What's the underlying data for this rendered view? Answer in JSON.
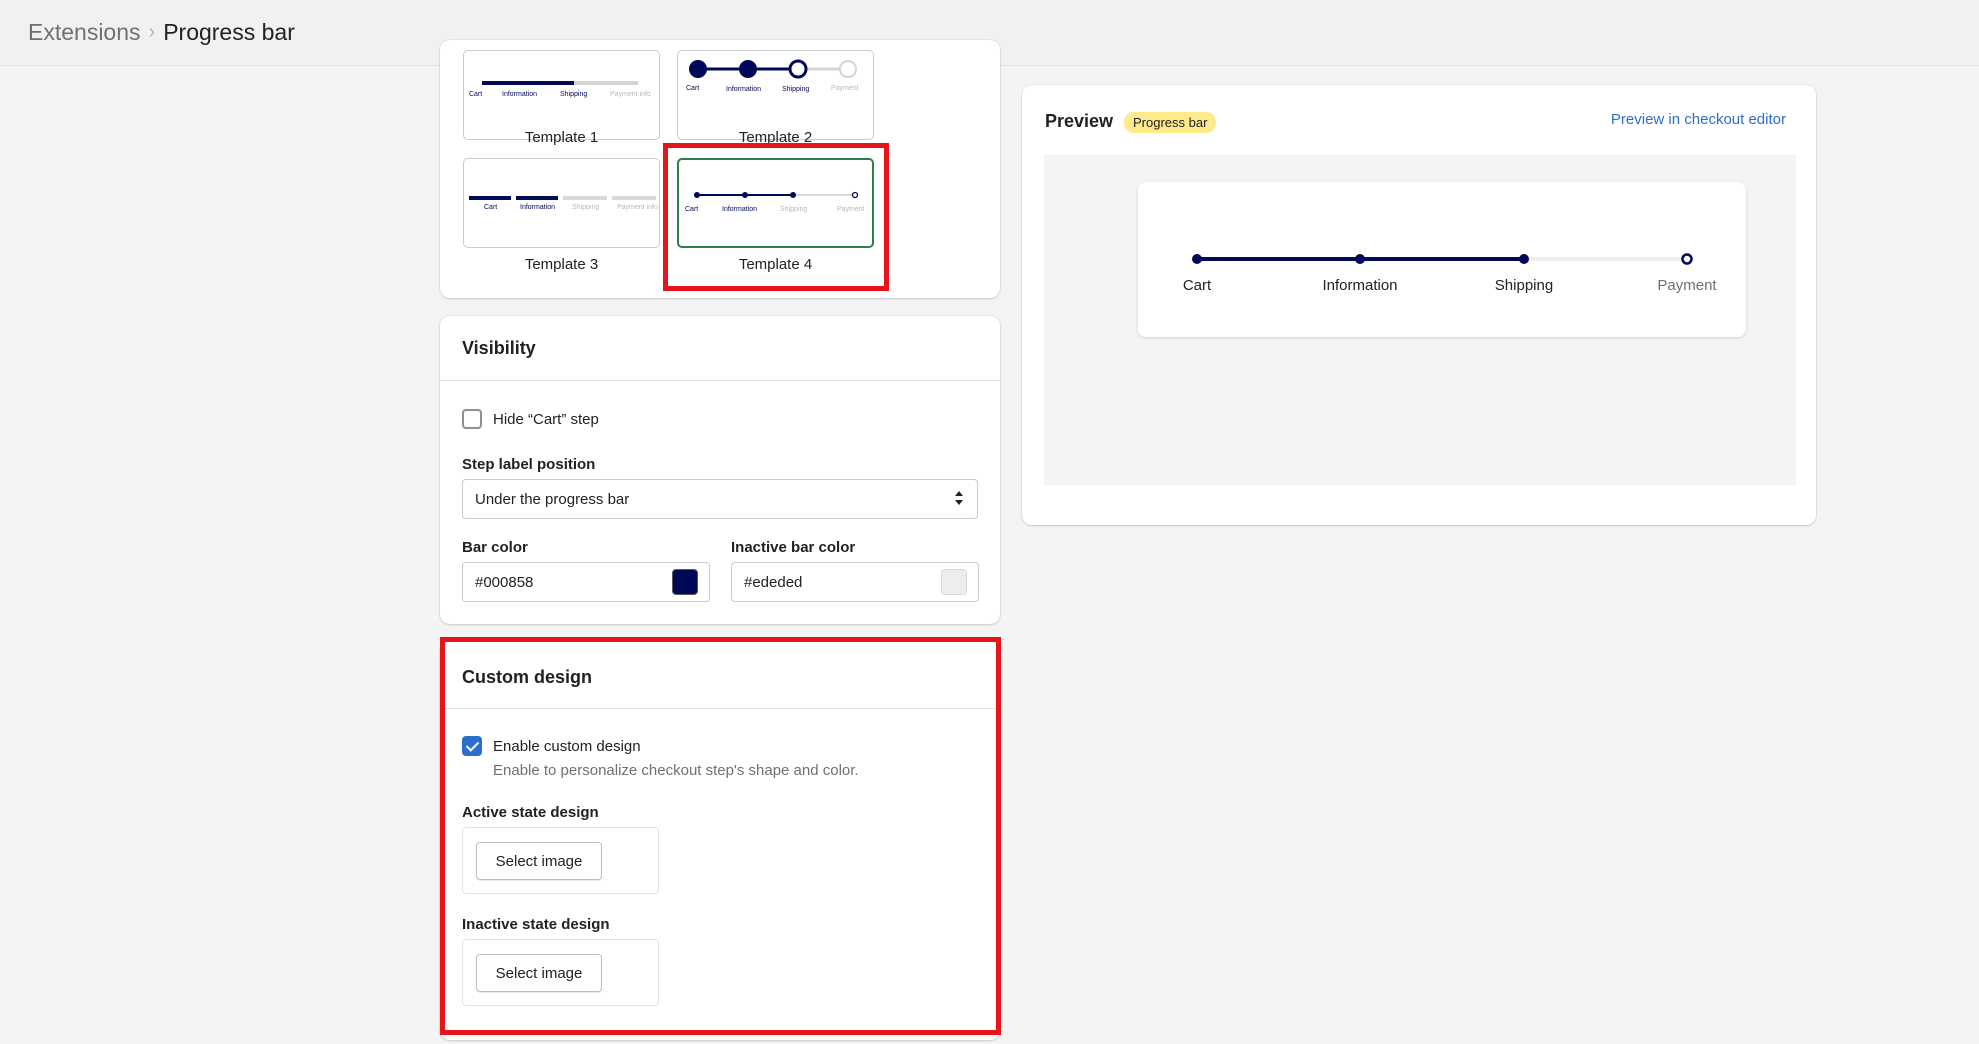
{
  "breadcrumb": {
    "parent": "Extensions",
    "separator": "›",
    "current": "Progress bar"
  },
  "templates": [
    {
      "label": "Template 1",
      "steps": [
        "Cart",
        "Information",
        "Shipping",
        "Payment info"
      ],
      "selected": false
    },
    {
      "label": "Template 2",
      "steps": [
        "Cart",
        "Information",
        "Shipping",
        "Payment"
      ],
      "selected": false
    },
    {
      "label": "Template 3",
      "steps": [
        "Cart",
        "Information",
        "Shipping",
        "Payment info"
      ],
      "selected": false
    },
    {
      "label": "Template 4",
      "steps": [
        "Cart",
        "Information",
        "Shipping",
        "Payment"
      ],
      "selected": true
    }
  ],
  "visibility": {
    "title": "Visibility",
    "hide_cart_label": "Hide “Cart” step",
    "hide_cart_checked": false,
    "step_label_position_label": "Step label position",
    "step_label_position_value": "Under the progress bar",
    "bar_color_label": "Bar color",
    "bar_color_value": "#000858",
    "inactive_bar_color_label": "Inactive bar color",
    "inactive_bar_color_value": "#ededed"
  },
  "custom_design": {
    "title": "Custom design",
    "enable_label": "Enable custom design",
    "enable_checked": true,
    "enable_help": "Enable to personalize checkout step's shape and color.",
    "active_label": "Active state design",
    "active_button": "Select image",
    "inactive_label": "Inactive state design",
    "inactive_button": "Select image"
  },
  "preview": {
    "title": "Preview",
    "badge": "Progress bar",
    "link": "Preview in checkout editor",
    "steps": [
      {
        "label": "Cart",
        "active": true
      },
      {
        "label": "Information",
        "active": true
      },
      {
        "label": "Shipping",
        "active": true
      },
      {
        "label": "Payment",
        "active": false
      }
    ]
  },
  "colors": {
    "bar": "#000858",
    "inactive_bar": "#ededed",
    "accent": "#2c6ecb",
    "selected_border": "#2e7d4f",
    "highlight": "#e8141b",
    "badge": "#ffea8a"
  }
}
